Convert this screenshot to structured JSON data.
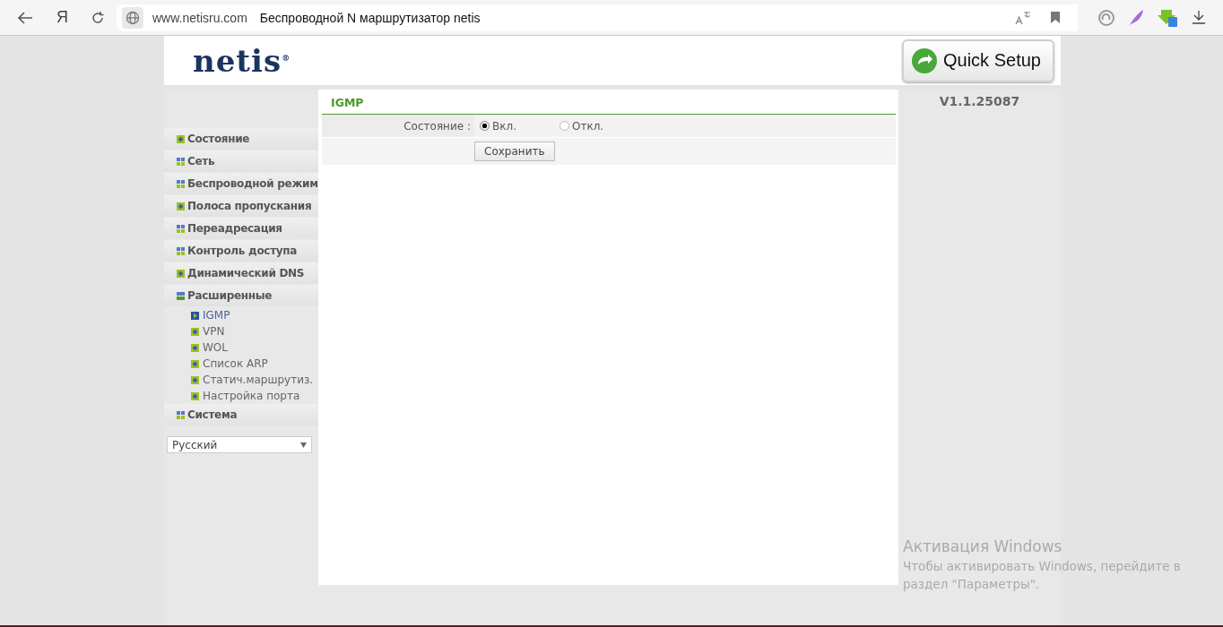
{
  "browser": {
    "yandex_button": "Я",
    "url": "www.netisru.com",
    "page_title": "Беспроводной N маршрутизатор netis"
  },
  "header": {
    "logo": "netis$^{®}$",
    "quick_setup": "Quick Setup",
    "version": "V1.1.25087"
  },
  "menu": [
    {
      "label": "Состояние",
      "kind": "page"
    },
    {
      "label": "Сеть",
      "kind": "group",
      "expanded": false
    },
    {
      "label": "Беспроводной режим",
      "kind": "group",
      "expanded": false
    },
    {
      "label": "Полоса пропускания",
      "kind": "page"
    },
    {
      "label": "Переадресация",
      "kind": "group",
      "expanded": false
    },
    {
      "label": "Контроль доступа",
      "kind": "group",
      "expanded": false
    },
    {
      "label": "Динамический DNS",
      "kind": "page"
    },
    {
      "label": "Расширенные",
      "kind": "group",
      "expanded": true,
      "children": [
        {
          "label": "IGMP",
          "selected": true
        },
        {
          "label": "VPN",
          "selected": false
        },
        {
          "label": "WOL",
          "selected": false
        },
        {
          "label": "Список ARP",
          "selected": false
        },
        {
          "label": "Статич.маршрутиз.",
          "selected": false
        },
        {
          "label": "Настройка порта",
          "selected": false
        }
      ]
    },
    {
      "label": "Система",
      "kind": "group",
      "expanded": false
    }
  ],
  "language": {
    "value": "Русский"
  },
  "panel": {
    "title": "IGMP",
    "state_label": "Состояние :",
    "options": [
      {
        "label": "Вкл.",
        "selected": true
      },
      {
        "label": "Откл.",
        "selected": false
      }
    ],
    "save_button": "Сохранить"
  },
  "activation": {
    "title": "Активация Windows",
    "text": "Чтобы активировать Windows, перейдите в раздел \"Параметры\"."
  }
}
